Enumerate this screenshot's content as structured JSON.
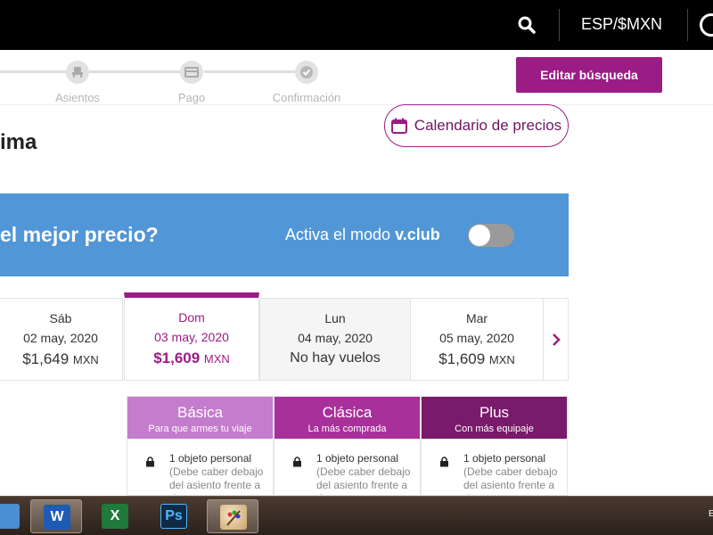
{
  "topbar": {
    "currency_label": "ESP/$MXN",
    "icons": [
      "search-icon",
      "user-icon"
    ]
  },
  "steps": [
    {
      "label": "Asientos",
      "icon": "seat-icon"
    },
    {
      "label": "Pago",
      "icon": "card-icon"
    },
    {
      "label": "Confirmación",
      "icon": "check-icon"
    }
  ],
  "actions": {
    "edit_search": "Editar búsqueda",
    "price_calendar": "Calendario de precios"
  },
  "page": {
    "title_partial": "ima"
  },
  "banner": {
    "question": "el mejor precio?",
    "club_prefix": "Activa el modo ",
    "club_name": "v.club",
    "toggle_on": false,
    "color": "#5196d6"
  },
  "days": [
    {
      "dayname": "Sáb",
      "date": "02 may, 2020",
      "price": "$1,649",
      "currency": "MXN",
      "selected": false
    },
    {
      "dayname": "Dom",
      "date": "03 may, 2020",
      "price": "$1,609",
      "currency": "MXN",
      "selected": true
    },
    {
      "dayname": "Lun",
      "date": "04 may, 2020",
      "no_flights": "No hay vuelos",
      "selected": false
    },
    {
      "dayname": "Mar",
      "date": "05 may, 2020",
      "price": "$1,609",
      "currency": "MXN",
      "selected": false
    }
  ],
  "fares": [
    {
      "name": "Básica",
      "subtitle": "Para que armes tu viaje",
      "color": "#c47ccc",
      "item": "1 objeto personal",
      "item_sub": "(Debe caber debajo del asiento frente a ti)"
    },
    {
      "name": "Clásica",
      "subtitle": "La más comprada",
      "color": "#a8309a",
      "item": "1 objeto personal",
      "item_sub": "(Debe caber debajo del asiento frente a ti)"
    },
    {
      "name": "Plus",
      "subtitle": "Con más equipaje",
      "color": "#7a1a6a",
      "item": "1 objeto personal",
      "item_sub": "(Debe caber debajo del asiento frente a ti)"
    }
  ],
  "taskbar": {
    "apps": [
      "windows-explorer-icon",
      "word-icon",
      "excel-icon",
      "photoshop-icon",
      "paint-icon"
    ],
    "labels": {
      "word": "W",
      "excel": "X",
      "photoshop": "Ps"
    },
    "clock_partial": "E"
  },
  "colors": {
    "brand": "#9b1c85",
    "banner": "#5196d6",
    "topbar": "#000000"
  }
}
